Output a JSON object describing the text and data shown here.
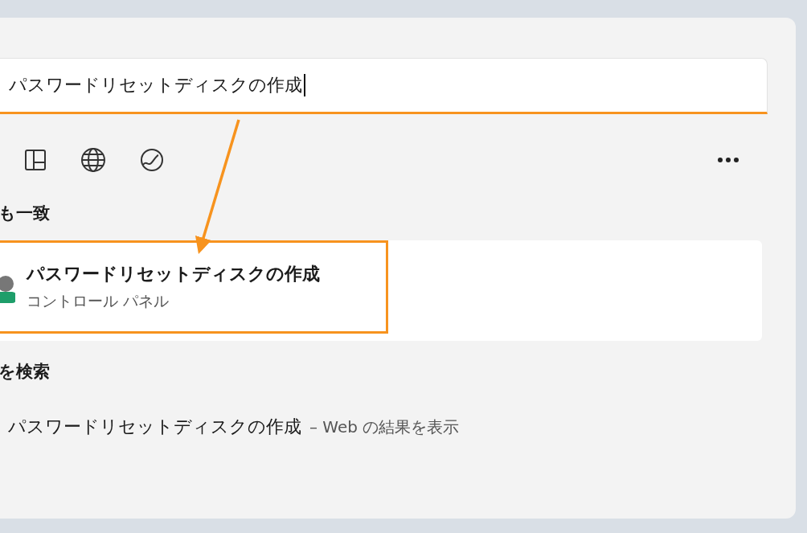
{
  "search": {
    "value": "パスワードリセットディスクの作成"
  },
  "best_match": {
    "heading": "も一致",
    "result": {
      "title": "パスワードリセットディスクの作成",
      "subtitle": "コントロール パネル",
      "highlighted": true
    }
  },
  "web_search": {
    "heading": "を検索",
    "query": "パスワードリセットディスクの作成",
    "suffix": "– Web の結果を表示"
  }
}
